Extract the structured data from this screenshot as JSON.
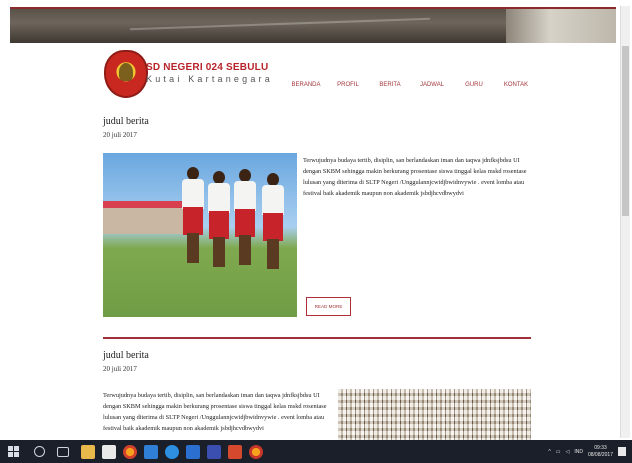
{
  "site": {
    "name": "SD NEGERI 024 SEBULU",
    "subtitle": "Kutai Kartanegara",
    "nav": [
      "BERANDA",
      "PROFIL",
      "BERITA",
      "JADWAL",
      "GURU",
      "KONTAK"
    ]
  },
  "posts": [
    {
      "title": "judul berita",
      "date": "20 juli 2017",
      "body": "Terwujudnya budaya tertib, disiplin, san berlandaskan iman dan taqwa jdnfksjbdsu UI dengan SKBM sehingga makin berkurang prosentase siswa tinggal kelas mskd rosentase lulusan yang diterima di SLTP Negeri /Unggulannjcwidjbwidnvywie . event lomba atau festival baik akademik maupun non akademik jsbdjhcvdbwydvi",
      "read_more": "READ MORE"
    },
    {
      "title": "judul berita",
      "date": "20 juli 2017",
      "body": "Terwujudnya budaya tertib, disiplin, san berlandaskan iman dan taqwa jdnfksjbdsu UI dengan SKBM sehingga makin berkurang prosentase siswa tinggal kelas mskd rosentase lulusan yang diterima di SLTP Negeri /Unggulannjcwidjbwidnvywie . event lomba atau festival baik akademik maupun non akademik jsbdjhcvdbwydvi"
    }
  ],
  "taskbar": {
    "icons": [
      "windows-start-icon",
      "search-icon",
      "task-view-icon",
      "file-explorer-icon",
      "store-icon",
      "firefox-icon",
      "photos-icon",
      "edge-icon",
      "mail-icon",
      "people-icon",
      "powerpoint-icon",
      "firefox-alt-icon"
    ],
    "language": "IND",
    "time": "09:33",
    "date": "08/08/2017"
  },
  "colors": {
    "accent": "#a2363c",
    "taskbar": "#1b1f2a"
  }
}
